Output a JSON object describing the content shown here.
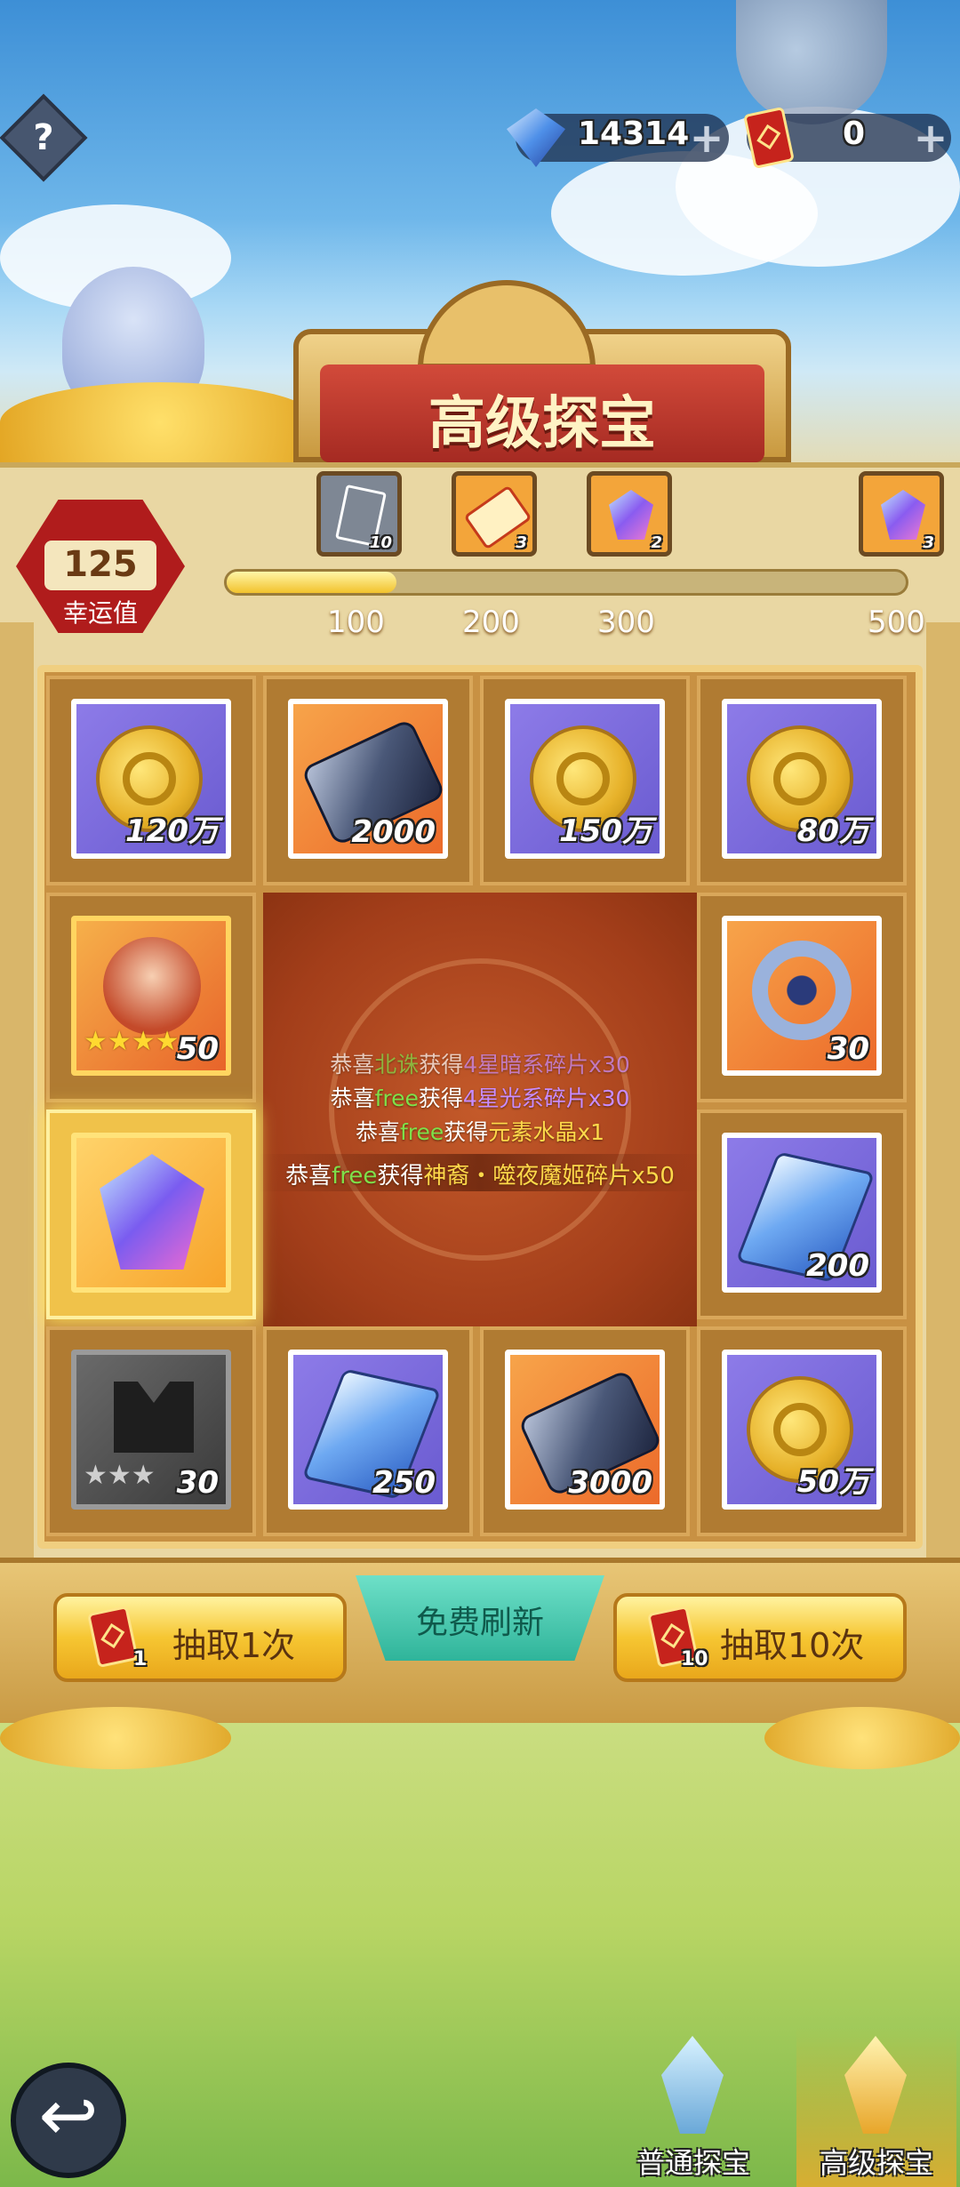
{
  "currency": {
    "diamonds": "14314",
    "tickets": "0"
  },
  "title": "高级探宝",
  "luck": {
    "value": "125",
    "label": "幸运值",
    "progress_fraction": 0.25
  },
  "milestones": [
    {
      "count": "10",
      "threshold": "100"
    },
    {
      "count": "3",
      "threshold": "200"
    },
    {
      "count": "2",
      "threshold": "300"
    },
    {
      "count": "3",
      "threshold": "500"
    }
  ],
  "grid": {
    "row1": [
      "120万",
      "2000",
      "150万",
      "80万"
    ],
    "hero_red": "50",
    "ring": "30",
    "crystal_right": "200",
    "hero_dark": "30",
    "row4": [
      "250",
      "3000",
      "50万"
    ]
  },
  "feed": {
    "line1": {
      "a": "恭喜",
      "name": "北诛",
      "b": "获得",
      "item": "4星暗系碎片x30"
    },
    "line2": {
      "a": "恭喜",
      "name": "free",
      "b": "获得",
      "item": "4星光系碎片x30"
    },
    "line3": {
      "a": "恭喜",
      "name": "free",
      "b": "获得",
      "item": "元素水晶x1"
    },
    "line4": {
      "a": "恭喜",
      "name": "free",
      "b": "获得",
      "item": "神裔・噬夜魔姬碎片x50"
    }
  },
  "actions": {
    "draw_one": "抽取1次",
    "draw_one_cost": "1",
    "free_refresh": "免费刷新",
    "draw_ten": "抽取10次",
    "draw_ten_cost": "10"
  },
  "nav": {
    "normal": "普通探宝",
    "advanced": "高级探宝"
  },
  "colors": {
    "accent_green": "#7ee04a",
    "accent_purple": "#c88cff",
    "accent_gold": "#ffd94a"
  }
}
